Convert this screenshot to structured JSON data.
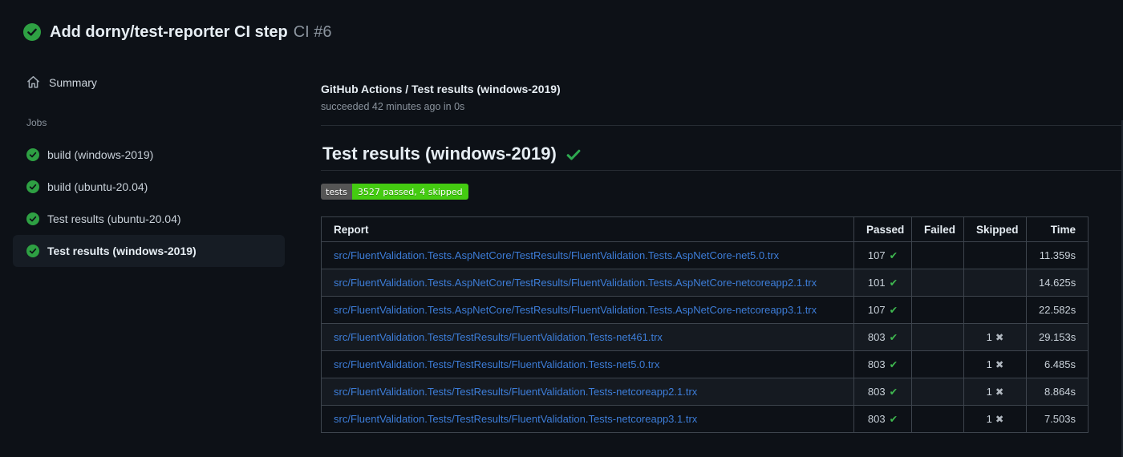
{
  "header": {
    "title": "Add dorny/test-reporter CI step",
    "run_number": "CI #6"
  },
  "sidebar": {
    "summary_label": "Summary",
    "jobs_section_label": "Jobs",
    "jobs": [
      {
        "label": "build (windows-2019)",
        "status": "success",
        "selected": false
      },
      {
        "label": "build (ubuntu-20.04)",
        "status": "success",
        "selected": false
      },
      {
        "label": "Test results (ubuntu-20.04)",
        "status": "success",
        "selected": false
      },
      {
        "label": "Test results (windows-2019)",
        "status": "success",
        "selected": true
      }
    ]
  },
  "main": {
    "breadcrumb": "GitHub Actions / Test results (windows-2019)",
    "status_line": "succeeded 42 minutes ago in 0s",
    "section_title": "Test results (windows-2019)",
    "badge": {
      "label": "tests",
      "value": "3527 passed, 4 skipped",
      "label_bg": "#555555",
      "value_bg": "#44cc11"
    },
    "table": {
      "headers": [
        "Report",
        "Passed",
        "Failed",
        "Skipped",
        "Time"
      ],
      "rows": [
        {
          "report": "src/FluentValidation.Tests.AspNetCore/TestResults/FluentValidation.Tests.AspNetCore-net5.0.trx",
          "passed": "107",
          "failed": "",
          "skipped": "",
          "time": "11.359s"
        },
        {
          "report": "src/FluentValidation.Tests.AspNetCore/TestResults/FluentValidation.Tests.AspNetCore-netcoreapp2.1.trx",
          "passed": "101",
          "failed": "",
          "skipped": "",
          "time": "14.625s"
        },
        {
          "report": "src/FluentValidation.Tests.AspNetCore/TestResults/FluentValidation.Tests.AspNetCore-netcoreapp3.1.trx",
          "passed": "107",
          "failed": "",
          "skipped": "",
          "time": "22.582s"
        },
        {
          "report": "src/FluentValidation.Tests/TestResults/FluentValidation.Tests-net461.trx",
          "passed": "803",
          "failed": "",
          "skipped": "1",
          "time": "29.153s"
        },
        {
          "report": "src/FluentValidation.Tests/TestResults/FluentValidation.Tests-net5.0.trx",
          "passed": "803",
          "failed": "",
          "skipped": "1",
          "time": "6.485s"
        },
        {
          "report": "src/FluentValidation.Tests/TestResults/FluentValidation.Tests-netcoreapp2.1.trx",
          "passed": "803",
          "failed": "",
          "skipped": "1",
          "time": "8.864s"
        },
        {
          "report": "src/FluentValidation.Tests/TestResults/FluentValidation.Tests-netcoreapp3.1.trx",
          "passed": "803",
          "failed": "",
          "skipped": "1",
          "time": "7.503s"
        }
      ]
    }
  },
  "icons": {
    "passed_check": "✔",
    "skipped_x": "✖"
  },
  "colors": {
    "page_bg": "#0d1117",
    "success_green": "#2ea043",
    "check_green": "#3fb950",
    "link_blue": "#3d7dd8",
    "text_primary": "#e6edf3",
    "text_secondary": "#8b949e",
    "table_border": "#3d444d",
    "row_alt_bg": "#151a21",
    "selected_job_bg": "#161c24"
  }
}
